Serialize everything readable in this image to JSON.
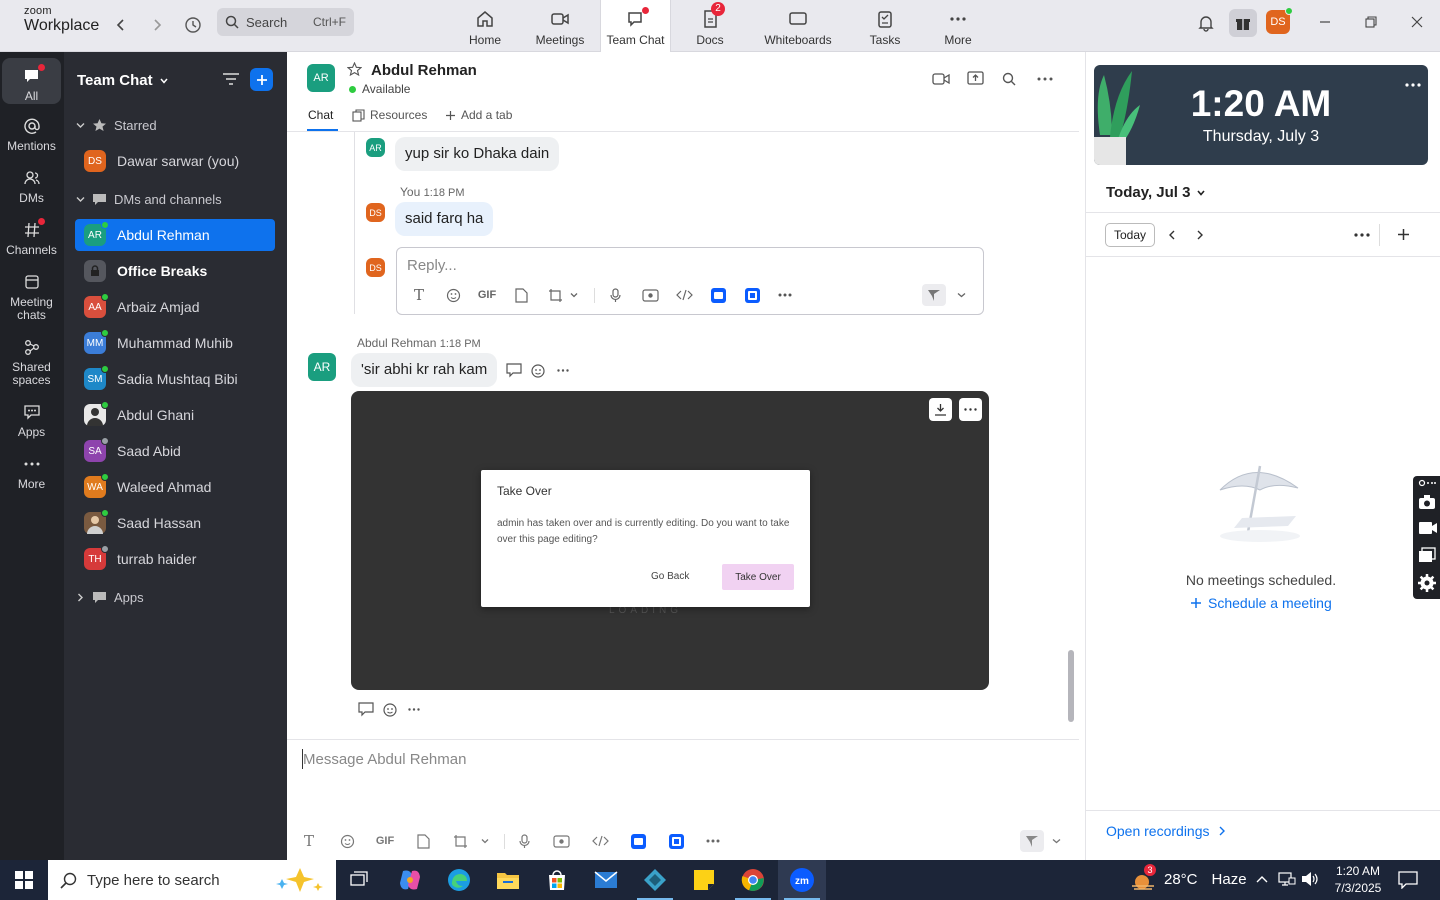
{
  "app": {
    "logo_line1": "zoom",
    "logo_line2": "Workplace",
    "search_placeholder": "Search",
    "search_shortcut": "Ctrl+F",
    "user_initials": "DS"
  },
  "nav_tabs": [
    {
      "label": "Home",
      "icon": "home-icon"
    },
    {
      "label": "Meetings",
      "icon": "video-icon"
    },
    {
      "label": "Team Chat",
      "icon": "chat-icon",
      "active": true
    },
    {
      "label": "Docs",
      "icon": "docs-icon",
      "badge": "2"
    },
    {
      "label": "Whiteboards",
      "icon": "whiteboard-icon"
    },
    {
      "label": "Tasks",
      "icon": "tasks-icon"
    },
    {
      "label": "More",
      "icon": "more-icon"
    }
  ],
  "rail": [
    {
      "label": "All",
      "icon": "chat-bubble-icon"
    },
    {
      "label": "Mentions",
      "icon": "at-icon"
    },
    {
      "label": "DMs",
      "icon": "people-icon"
    },
    {
      "label": "Channels",
      "icon": "hash-icon"
    },
    {
      "label": "Meeting chats",
      "icon": "calendar-icon"
    },
    {
      "label": "Shared spaces",
      "icon": "share-icon"
    },
    {
      "label": "Apps",
      "icon": "apps-icon"
    },
    {
      "label": "More",
      "icon": "more-icon"
    }
  ],
  "sidebar": {
    "title": "Team Chat",
    "starred_label": "Starred",
    "starred_items": [
      {
        "initials": "DS",
        "name": "Dawar sarwar (you)",
        "color": "#e0651e"
      }
    ],
    "dms_label": "DMs and channels",
    "dm_items": [
      {
        "initials": "AR",
        "name": "Abdul Rehman",
        "color": "#1a9e7f",
        "presence": "#2ecc40",
        "active": true
      },
      {
        "initials": "",
        "name": "Office Breaks",
        "color": "#55575e",
        "lock": true,
        "bold": true
      },
      {
        "initials": "AA",
        "name": "Arbaiz Amjad",
        "color": "#d94f3d",
        "presence": "#2ecc40"
      },
      {
        "initials": "MM",
        "name": "Muhammad Muhib",
        "color": "#3b7dd8",
        "presence": "#2ecc40"
      },
      {
        "initials": "SM",
        "name": "Sadia Mushtaq Bibi",
        "color": "#1e88c8",
        "presence": "#2ecc40"
      },
      {
        "initials": "",
        "name": "Abdul Ghani",
        "color": "#cfcfcf",
        "photo": true,
        "presence": "#2ecc40"
      },
      {
        "initials": "SA",
        "name": "Saad Abid",
        "color": "#8e44ad",
        "presence": "#9aa"
      },
      {
        "initials": "WA",
        "name": "Waleed Ahmad",
        "color": "#e07b1e",
        "presence": "#2ecc40"
      },
      {
        "initials": "",
        "name": "Saad Hassan",
        "color": "#7a5a40",
        "photo": true,
        "presence": "#2ecc40"
      },
      {
        "initials": "TH",
        "name": "turrab haider",
        "color": "#d63a3a",
        "presence": "#9aa"
      }
    ],
    "apps_label": "Apps"
  },
  "chat": {
    "contact_initials": "AR",
    "contact_name": "Abdul Rehman",
    "status": "Available",
    "tabs": [
      "Chat",
      "Resources",
      "Add a tab"
    ],
    "messages": {
      "m1": "yup sir ko Dhaka dain",
      "m2_meta_name": "You",
      "m2_meta_time": "1:18 PM",
      "m2": "said farq ha",
      "reply_placeholder": "Reply...",
      "m3_meta_name": "Abdul Rehman",
      "m3_meta_time": "1:18 PM",
      "m3": "'sir abhi kr rah kam"
    },
    "attachment": {
      "dialog_title": "Take Over",
      "dialog_body": "admin has taken over and is currently editing. Do you want to take over this page editing?",
      "go_back": "Go Back",
      "take_over": "Take Over",
      "loading_text": "LOADING"
    },
    "message_placeholder": "Message Abdul Rehman",
    "gif_label": "GIF"
  },
  "calendar": {
    "time": "1:20 AM",
    "date": "Thursday, July 3",
    "day_selector": "Today, Jul 3",
    "today_button": "Today",
    "empty_text": "No meetings scheduled.",
    "schedule_link": "Schedule a meeting",
    "open_recordings": "Open recordings"
  },
  "taskbar": {
    "search_placeholder": "Type here to search",
    "weather_temp": "28°C",
    "weather_text": "Haze",
    "weather_badge": "3",
    "clock_time": "1:20 AM",
    "clock_date": "7/3/2025"
  }
}
